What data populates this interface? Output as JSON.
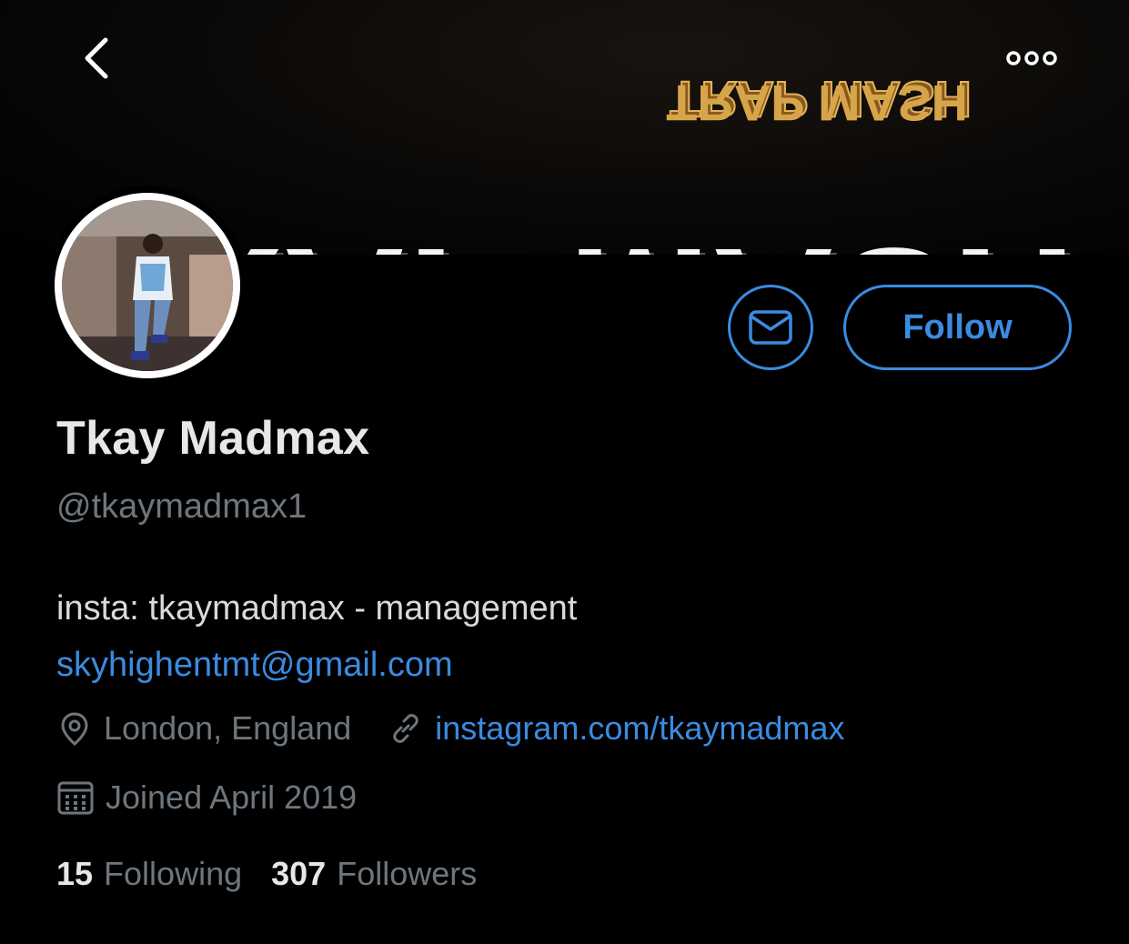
{
  "header": {
    "back_icon": "chevron-left-icon",
    "more_icon": "more-dots-icon"
  },
  "banner": {
    "text_small": "TRAP MASH",
    "text_large": "TRAP MASH"
  },
  "profile": {
    "display_name": "Tkay Madmax",
    "handle": "@tkaymadmax1",
    "bio_line1": "insta: tkaymadmax - management",
    "bio_email": "skyhighentmt@gmail.com",
    "location": "London, England",
    "website": "instagram.com/tkaymadmax",
    "joined": "Joined April 2019"
  },
  "actions": {
    "message_icon": "mail-icon",
    "follow_label": "Follow"
  },
  "stats": {
    "following_count": "15",
    "following_label": "Following",
    "followers_count": "307",
    "followers_label": "Followers"
  },
  "colors": {
    "accent": "#3b8be0",
    "background": "#000000",
    "text_primary": "#e7e7e7",
    "text_secondary": "#6e767d"
  }
}
